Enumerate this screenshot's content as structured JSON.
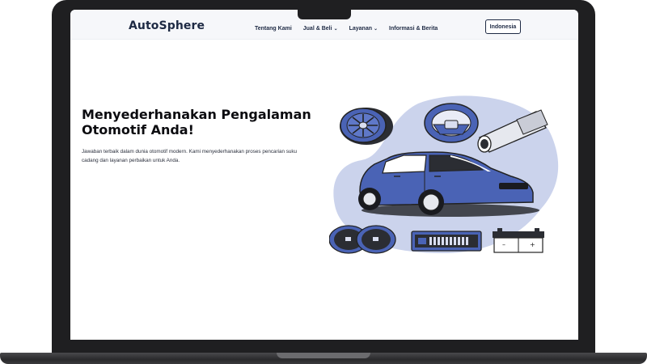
{
  "nav": {
    "logo": "AutoSphere",
    "items": [
      {
        "label": "Tentang Kami"
      },
      {
        "label": "Jual & Beli"
      },
      {
        "label": "Layanan"
      },
      {
        "label": "Informasi & Berita"
      }
    ],
    "language_button": "Indonesia"
  },
  "hero": {
    "title": "Menyederhanakan Pengalaman Otomotif Anda!",
    "subtitle": "Jawaban terbaik dalam dunia otomotif modern. Kami menyederhanakan proses pencarian suku cadang dan layanan perbaikan untuk Anda."
  },
  "colors": {
    "brand_blue": "#4a63b5",
    "blob": "#cbd3ec",
    "text_dark": "#1e2a44"
  }
}
